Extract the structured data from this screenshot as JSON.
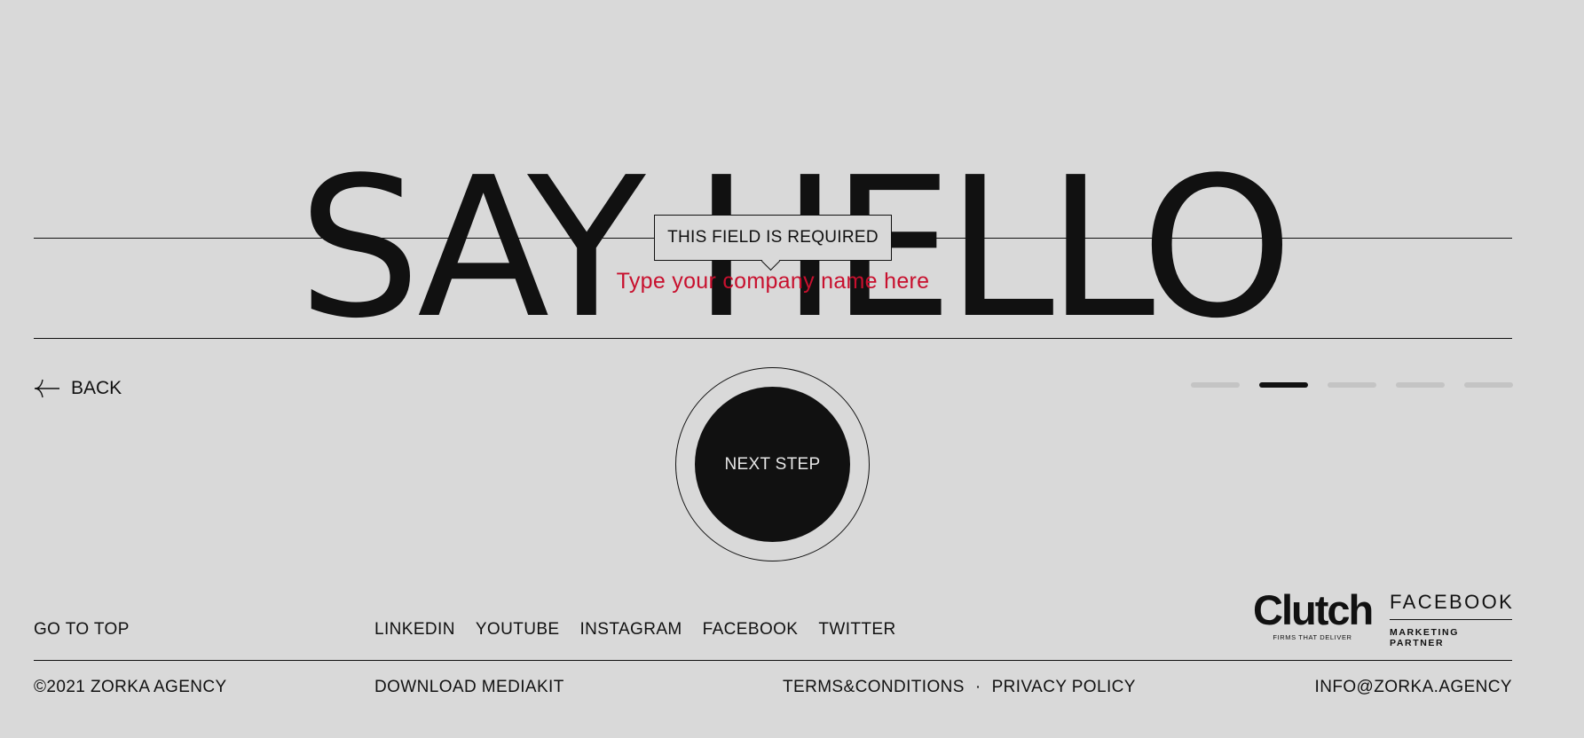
{
  "hero": {
    "title": "SAY HELLO"
  },
  "form": {
    "tooltip": "THIS FIELD IS REQUIRED",
    "placeholder": "Type your company name here"
  },
  "nav": {
    "back_label": "BACK",
    "next_label": "NEXT STEP",
    "steps_total": 5,
    "steps_active_index": 1
  },
  "footer": {
    "go_to_top": "GO TO TOP",
    "socials": [
      "LINKEDIN",
      "YOUTUBE",
      "INSTAGRAM",
      "FACEBOOK",
      "TWITTER"
    ],
    "badges": {
      "clutch_name": "Clutch",
      "clutch_tagline": "FIRMS THAT DELIVER",
      "facebook_name": "FACEBOOK",
      "facebook_tagline": "MARKETING PARTNER"
    },
    "copyright": "©2021 ZORKA AGENCY",
    "download": "DOWNLOAD MEDIAKIT",
    "terms": "TERMS&CONDITIONS",
    "separator": "·",
    "privacy": "PRIVACY POLICY",
    "email": "INFO@ZORKA.AGENCY"
  },
  "colors": {
    "background": "#d9d9d9",
    "text": "#111111",
    "error": "#c8102e",
    "step_inactive": "#c4c4c4"
  }
}
